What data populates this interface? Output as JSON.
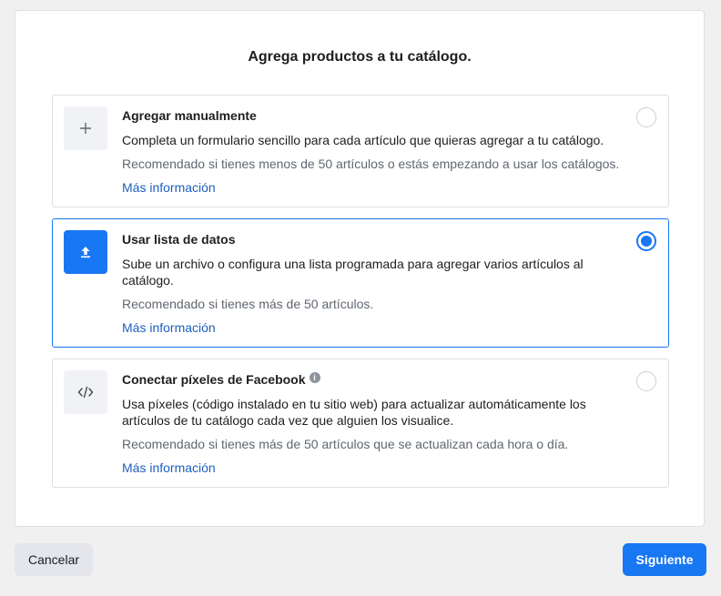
{
  "dialog": {
    "title": "Agrega productos a tu catálogo."
  },
  "options": [
    {
      "icon": "plus-icon",
      "title": "Agregar manualmente",
      "description": "Completa un formulario sencillo para cada artículo que quieras agregar a tu catálogo.",
      "recommendation": "Recomendado si tienes menos de 50 artículos o estás empezando a usar los catálogos.",
      "link": "Más información",
      "selected": false
    },
    {
      "icon": "upload-icon",
      "title": "Usar lista de datos",
      "description": "Sube un archivo o configura una lista programada para agregar varios artículos al catálogo.",
      "recommendation": "Recomendado si tienes más de 50 artículos.",
      "link": "Más información",
      "selected": true
    },
    {
      "icon": "code-icon",
      "title": "Conectar píxeles de Facebook",
      "info_icon": "info-icon",
      "description": "Usa píxeles (código instalado en tu sitio web) para actualizar automáticamente los artículos de tu catálogo cada vez que alguien los visualice.",
      "recommendation": "Recomendado si tienes más de 50 artículos que se actualizan cada hora o día.",
      "link": "Más información",
      "selected": false
    }
  ],
  "footer": {
    "cancel_label": "Cancelar",
    "next_label": "Siguiente"
  },
  "colors": {
    "accent": "#1877f2",
    "link": "#1d5fbf",
    "background": "#f0f0f0"
  }
}
